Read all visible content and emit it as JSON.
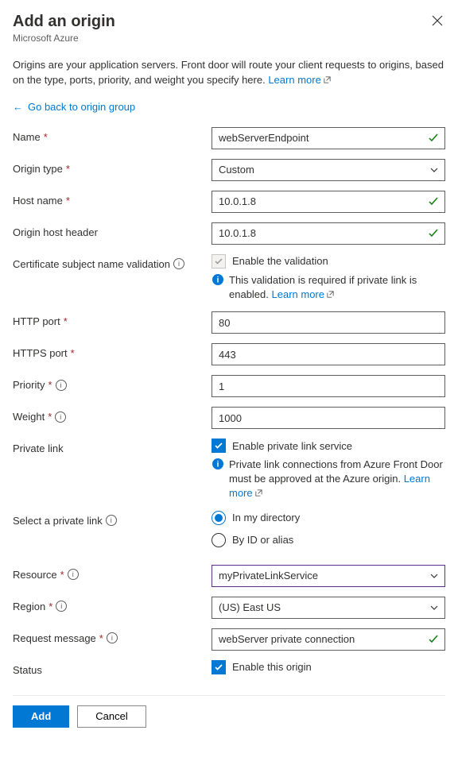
{
  "header": {
    "title": "Add an origin",
    "subtitle": "Microsoft Azure"
  },
  "description": {
    "text": "Origins are your application servers. Front door will route your client requests to origins, based on the type, ports, priority, and weight you specify here. ",
    "link": "Learn more"
  },
  "backLink": "Go back to origin group",
  "labels": {
    "name": "Name",
    "originType": "Origin type",
    "hostName": "Host name",
    "originHostHeader": "Origin host header",
    "certValidation": "Certificate subject name validation",
    "httpPort": "HTTP port",
    "httpsPort": "HTTPS port",
    "priority": "Priority",
    "weight": "Weight",
    "privateLink": "Private link",
    "selectPrivateLink": "Select a private link",
    "resource": "Resource",
    "region": "Region",
    "requestMessage": "Request message",
    "status": "Status"
  },
  "values": {
    "name": "webServerEndpoint",
    "originType": "Custom",
    "hostName": "10.0.1.8",
    "originHostHeader": "10.0.1.8",
    "httpPort": "80",
    "httpsPort": "443",
    "priority": "1",
    "weight": "1000",
    "resource": "myPrivateLinkService",
    "region": "(US) East US",
    "requestMessage": "webServer private connection"
  },
  "checks": {
    "enableValidation": "Enable the validation",
    "validationNote": "This validation is required if private link is enabled. ",
    "validationNoteLink": "Learn more",
    "enablePrivateLink": "Enable private link service",
    "privateLinkNote": "Private link connections from Azure Front Door must be approved at the Azure origin. ",
    "privateLinkNoteLink": "Learn more",
    "enableOrigin": "Enable this origin"
  },
  "radios": {
    "inDirectory": "In my directory",
    "byId": "By ID or alias"
  },
  "buttons": {
    "add": "Add",
    "cancel": "Cancel"
  }
}
